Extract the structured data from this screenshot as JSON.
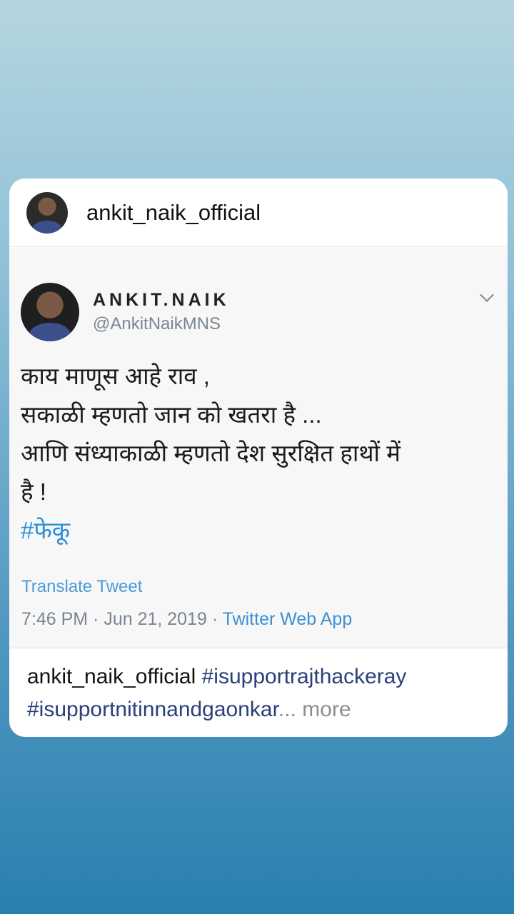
{
  "post": {
    "username": "ankit_naik_official"
  },
  "tweet": {
    "display_name": "ANKIT.NAIK",
    "handle": "@AnkitNaikMNS",
    "lines": [
      "काय माणूस आहे राव ,",
      "सकाळी म्हणतो जान को खतरा है ...",
      "आणि संध्याकाळी म्हणतो देश सुरक्षित हाथों में",
      "है !"
    ],
    "hashtag": "#फेकू",
    "translate_label": "Translate Tweet",
    "time": "7:46 PM",
    "date": "Jun 21, 2019",
    "source": "Twitter Web App",
    "separator": " · "
  },
  "caption": {
    "username": "ankit_naik_official",
    "tag1": "#isupportrajthackeray",
    "tag2": "#isupportnitinnandgaonkar",
    "ellipsis": "...",
    "more": " more"
  },
  "icons": {
    "avatar": "profile-photo",
    "menu": "chevron-down-icon"
  }
}
